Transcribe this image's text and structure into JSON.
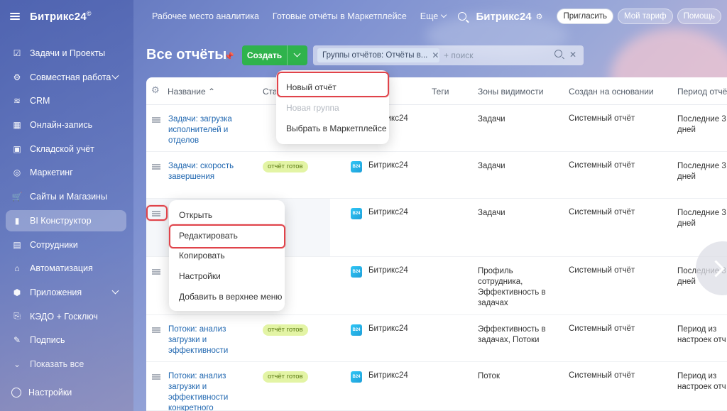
{
  "app": {
    "logo": "Битрикс24",
    "logo_mark": "©"
  },
  "sidebar": {
    "items": [
      {
        "label": "Задачи и Проекты",
        "icon": "checkbox-icon"
      },
      {
        "label": "Совместная работа",
        "icon": "chat-icon",
        "has_chevron": true
      },
      {
        "label": "CRM",
        "icon": "crm-icon"
      },
      {
        "label": "Онлайн-запись",
        "icon": "calendar-icon"
      },
      {
        "label": "Складской учёт",
        "icon": "warehouse-icon"
      },
      {
        "label": "Маркетинг",
        "icon": "target-icon"
      },
      {
        "label": "Сайты и Магазины",
        "icon": "cart-icon"
      },
      {
        "label": "BI Конструктор",
        "icon": "chart-icon",
        "active": true
      },
      {
        "label": "Сотрудники",
        "icon": "people-icon"
      },
      {
        "label": "Автоматизация",
        "icon": "robot-icon"
      },
      {
        "label": "Приложения",
        "icon": "cube-icon",
        "has_chevron": true
      },
      {
        "label": "КЭДО + Госключ",
        "icon": "document-icon"
      },
      {
        "label": "Подпись",
        "icon": "pen-icon"
      }
    ],
    "show_all": "Показать все",
    "settings": "Настройки"
  },
  "topbar": {
    "links": [
      "Рабочее место аналитика",
      "Готовые отчёты в Маркетплейсе"
    ],
    "more": "Еще",
    "logo": "Битрикс24",
    "invite": "Пригласить",
    "plan": "Мой тариф",
    "help": "Помощь"
  },
  "page": {
    "title": "Все отчёты",
    "create_label": "Создать",
    "filter_tag": "Группы отчётов: Отчёты в...",
    "search_placeholder": "+ поиск"
  },
  "grid": {
    "columns": [
      "Название",
      "Ста",
      "Теги",
      "Зоны видимости",
      "Создан на основании",
      "Период отчё"
    ],
    "rows": [
      {
        "name": "Задачи: загрузка исполнителей и отделов",
        "status": "",
        "source": "Битрикс24",
        "visibility": "Задачи",
        "based_on": "Системный отчёт",
        "period": "Последние 3 дней"
      },
      {
        "name": "Задачи: скорость завершения",
        "status": "отчёт готов",
        "source": "Битрикс24",
        "visibility": "Задачи",
        "based_on": "Системный отчёт",
        "period": "Последние 3 дней"
      },
      {
        "name": "",
        "status": "ов",
        "source": "Битрикс24",
        "visibility": "Задачи",
        "based_on": "Системный отчёт",
        "period": "Последние 3 дней"
      },
      {
        "name": "",
        "status": "ов",
        "source": "Битрикс24",
        "visibility": "Профиль сотрудника, Эффективность в задачах",
        "based_on": "Системный отчёт",
        "period": "Последние 3 дней"
      },
      {
        "name": "Потоки: анализ загрузки и эффективности",
        "status": "отчёт готов",
        "source": "Битрикс24",
        "visibility": "Эффективность в задачах, Потоки",
        "based_on": "Системный отчёт",
        "period": "Период из настроек отч"
      },
      {
        "name": "Потоки: анализ загрузки и эффективности конкретного",
        "status": "отчёт готов",
        "source": "Битрикс24",
        "visibility": "Поток",
        "based_on": "Системный отчёт",
        "period": "Период из настроек отч"
      }
    ]
  },
  "create_menu": {
    "items": [
      "Новый отчёт",
      "Новая группа",
      "Выбрать в Маркетплейсе"
    ]
  },
  "row_menu": {
    "items": [
      "Открыть",
      "Редактировать",
      "Копировать",
      "Настройки",
      "Добавить в верхнее меню"
    ]
  },
  "colors": {
    "create_green": "#2fb34c",
    "link_blue": "#2067b0",
    "badge_green": "#e3f4a5",
    "highlight_red": "#e0434a"
  }
}
